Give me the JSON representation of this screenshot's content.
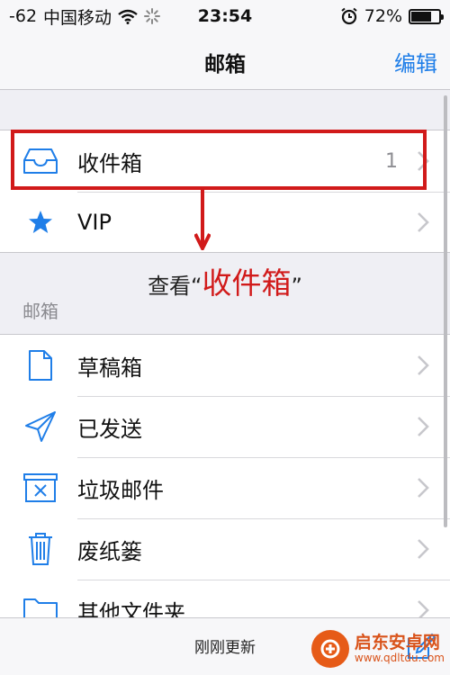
{
  "status_bar": {
    "signal": "-62",
    "carrier": "中国移动",
    "time": "23:54",
    "battery_text": "72%",
    "battery_level": 0.72,
    "wifi_icon": "wifi-icon",
    "spinner_icon": "activity-spinner-icon",
    "alarm_icon": "alarm-icon"
  },
  "nav": {
    "title": "邮箱",
    "edit_label": "编辑"
  },
  "section_1": {
    "items": [
      {
        "label": "收件箱",
        "count": "1",
        "icon": "inbox-icon"
      },
      {
        "label": "VIP",
        "icon": "star-icon"
      }
    ]
  },
  "annotation": {
    "prefix": "查看“",
    "highlight": "收件箱",
    "suffix": "”"
  },
  "section_2": {
    "header": "邮箱",
    "items": [
      {
        "label": "草稿箱",
        "icon": "draft-document-icon"
      },
      {
        "label": "已发送",
        "icon": "paper-plane-icon"
      },
      {
        "label": "垃圾邮件",
        "icon": "junk-box-icon"
      },
      {
        "label": "废纸篓",
        "icon": "trash-icon"
      },
      {
        "label": "其他文件夹",
        "icon": "folder-icon"
      }
    ]
  },
  "toolbar": {
    "status": "刚刚更新",
    "compose_icon": "compose-icon"
  },
  "watermark": {
    "name": "启东安卓网",
    "url": "www.qdltdu.com"
  },
  "colors": {
    "accent": "#1f7ee8",
    "annotation": "#d11a1a",
    "background": "#efeff4"
  }
}
